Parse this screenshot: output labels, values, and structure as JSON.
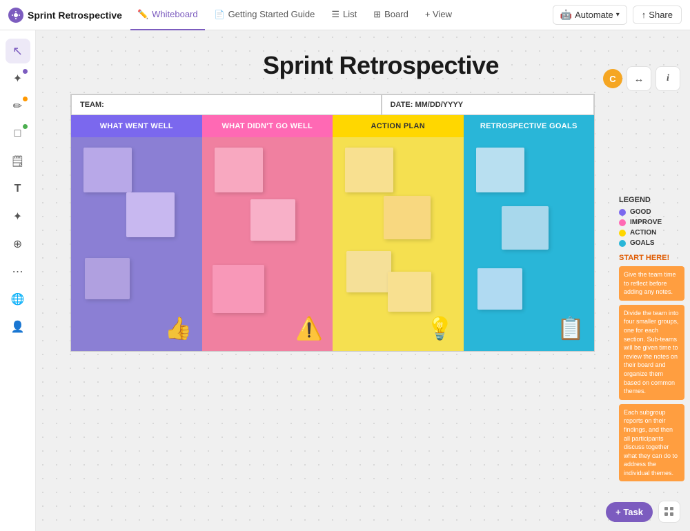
{
  "app": {
    "logo_text": "Sprint Retrospective",
    "logo_icon": "✦"
  },
  "nav": {
    "tabs": [
      {
        "id": "whiteboard",
        "label": "Whiteboard",
        "icon": "✏️",
        "active": true
      },
      {
        "id": "getting-started",
        "label": "Getting Started Guide",
        "icon": "📄",
        "active": false
      },
      {
        "id": "list",
        "label": "List",
        "icon": "≡",
        "active": false
      },
      {
        "id": "board",
        "label": "Board",
        "icon": "⊞",
        "active": false
      }
    ],
    "view_label": "+ View",
    "automate_label": "Automate",
    "share_label": "Share",
    "avatar": "C"
  },
  "toolbar": {
    "tools": [
      {
        "id": "select",
        "icon": "↖",
        "active": true,
        "dot": null
      },
      {
        "id": "pen",
        "icon": "✦",
        "active": false,
        "dot": "purple"
      },
      {
        "id": "draw",
        "icon": "✏",
        "active": false,
        "dot": "orange"
      },
      {
        "id": "shape",
        "icon": "□",
        "active": false,
        "dot": "green"
      },
      {
        "id": "note",
        "icon": "🗒",
        "active": false,
        "dot": null
      },
      {
        "id": "text",
        "icon": "T",
        "active": false,
        "dot": null
      },
      {
        "id": "spark",
        "icon": "✦",
        "active": false,
        "dot": null
      },
      {
        "id": "org",
        "icon": "⊕",
        "active": false,
        "dot": null
      },
      {
        "id": "connect",
        "icon": "✦",
        "active": false,
        "dot": null
      },
      {
        "id": "globe",
        "icon": "🌐",
        "active": false,
        "dot": null
      },
      {
        "id": "profile",
        "icon": "👤",
        "active": false,
        "dot": null
      }
    ]
  },
  "board": {
    "title": "Sprint Retrospective",
    "team_label": "TEAM:",
    "date_label": "DATE: MM/DD/YYYY",
    "columns": [
      {
        "id": "went-well",
        "header": "WHAT WENT WELL",
        "color": "#7b68ee",
        "body_color": "#8b7fd4"
      },
      {
        "id": "didnt-go",
        "header": "WHAT DIDN'T GO WELL",
        "color": "#ff69b4",
        "body_color": "#f080a0"
      },
      {
        "id": "action-plan",
        "header": "ACTION PLAN",
        "color": "#ffd700",
        "header_text_color": "#333",
        "body_color": "#f5e050"
      },
      {
        "id": "retro-goals",
        "header": "RETROSPECTIVE GOALS",
        "color": "#29b6d8",
        "body_color": "#29b6d8"
      }
    ]
  },
  "legend": {
    "title": "LEGEND",
    "items": [
      {
        "label": "GOOD",
        "color": "#7b68ee"
      },
      {
        "label": "IMPROVE",
        "color": "#ff69b4"
      },
      {
        "label": "ACTION",
        "color": "#ffd700"
      },
      {
        "label": "GOALS",
        "color": "#29b6d8"
      }
    ],
    "start_here": "START HERE!",
    "instructions": [
      "Give the team time to reflect before adding any notes.",
      "Divide the team into four smaller groups, one for each section. Sub-teams will be given time to review the notes on their board and organize them based on common themes.",
      "Each subgroup reports on their findings, and then all participants discuss together what they can do to address the individual themes."
    ]
  },
  "bottom": {
    "task_label": "+ Task",
    "apps_icon": "⋯"
  }
}
